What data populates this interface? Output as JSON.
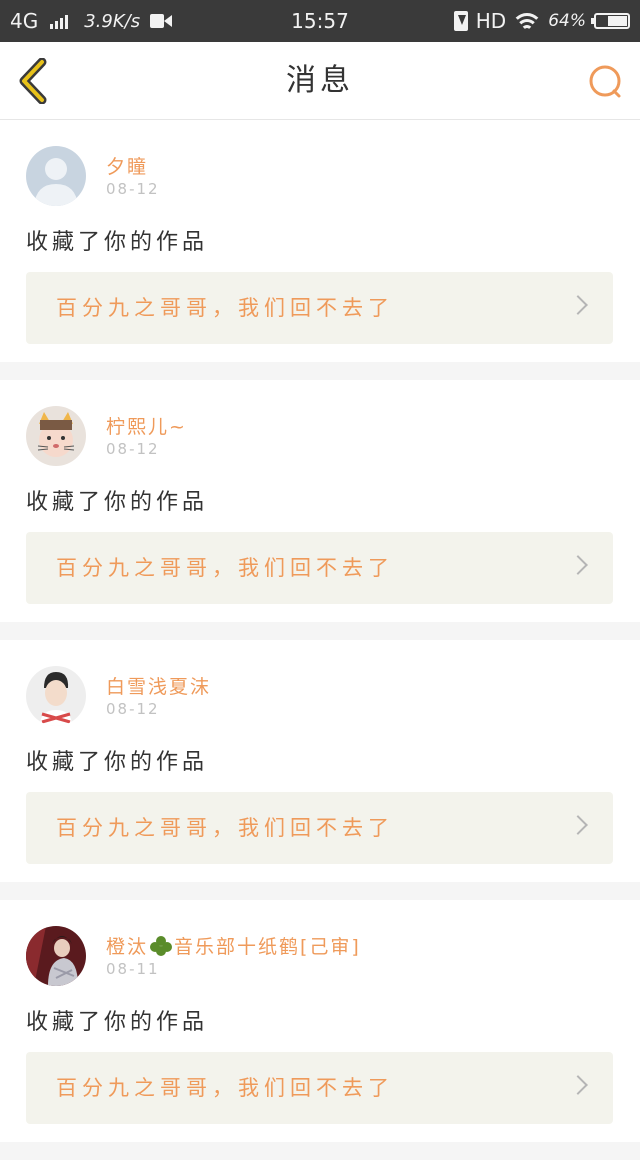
{
  "status_bar": {
    "network": "4G",
    "speed": "3.9K/s",
    "time": "15:57",
    "hd": "HD",
    "battery_percent": "64%",
    "battery_level": 0.64,
    "icons": [
      "signal-icon",
      "video-icon",
      "charging-icon",
      "wifi-icon",
      "battery-icon"
    ]
  },
  "header": {
    "title": "消息",
    "back_icon": "chevron-left-icon",
    "search_icon": "search-icon"
  },
  "colors": {
    "accent": "#ef9a5a",
    "back_icon": "#e8c21a",
    "card_link_bg": "#f3f3ec",
    "page_bg": "#f5f5f5",
    "status_bar_bg": "#3a3a3a"
  },
  "messages": [
    {
      "user_name": "夕瞳",
      "date": "08-12",
      "action": "收藏了你的作品",
      "work_title": "百分九之哥哥，我们回不去了",
      "avatar": "default-avatar"
    },
    {
      "user_name": "柠熙儿~",
      "date": "08-12",
      "action": "收藏了你的作品",
      "work_title": "百分九之哥哥，我们回不去了",
      "avatar": "photo-avatar"
    },
    {
      "user_name": "白雪浅夏沫",
      "date": "08-12",
      "action": "收藏了你的作品",
      "work_title": "百分九之哥哥，我们回不去了",
      "avatar": "photo-avatar"
    },
    {
      "user_name_prefix": "橙汰",
      "user_name_suffix": "音乐部十纸鹤[己审]",
      "user_name_icon": "clover-icon",
      "date": "08-11",
      "action": "收藏了你的作品",
      "work_title": "百分九之哥哥，我们回不去了",
      "avatar": "photo-avatar"
    }
  ]
}
